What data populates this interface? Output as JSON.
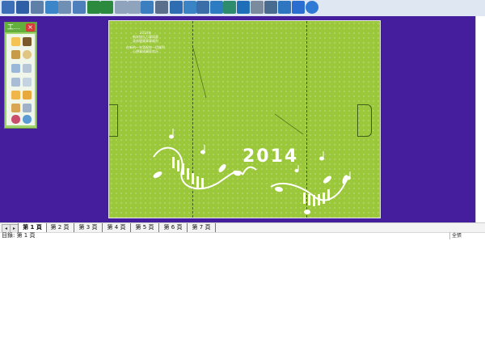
{
  "colors": {
    "workspace": "#441e9c",
    "card_green": "#9bc73a",
    "panel_green": "#62b03b",
    "toolbar_bg": "#dfe7f2"
  },
  "toolbar": {
    "icons": [
      "new-icon",
      "save-icon",
      "print-icon",
      "image-icon",
      "print-preview-icon",
      "view-icon",
      "prev-page-icon",
      "next-page-icon",
      "undo-icon",
      "redo-icon",
      "refresh-icon",
      "zoom-icon",
      "picture-icon",
      "photo-icon",
      "person-icon",
      "chart-icon",
      "scanner-icon",
      "stamp-icon",
      "calendar-icon",
      "help-icon",
      "share-icon",
      "play-icon"
    ]
  },
  "tool_panel": {
    "title": "工…",
    "close_label": "×"
  },
  "card": {
    "greeting_lines": "2014年\n新年快乐万事如意\n身体健康事事顺利",
    "greeting_lines2": "在新的一年里祝你一切顺利\n心想事成阖家欢乐",
    "year": "2014"
  },
  "sheet_tabs": {
    "tabs": [
      "第 1 頁",
      "第 2 頁",
      "第 3 頁",
      "第 4 頁",
      "第 5 頁",
      "第 6 頁",
      "第 7 頁"
    ],
    "active_index": 0
  },
  "status": {
    "left": "目錄: 第 1 頁",
    "right": "全張"
  }
}
